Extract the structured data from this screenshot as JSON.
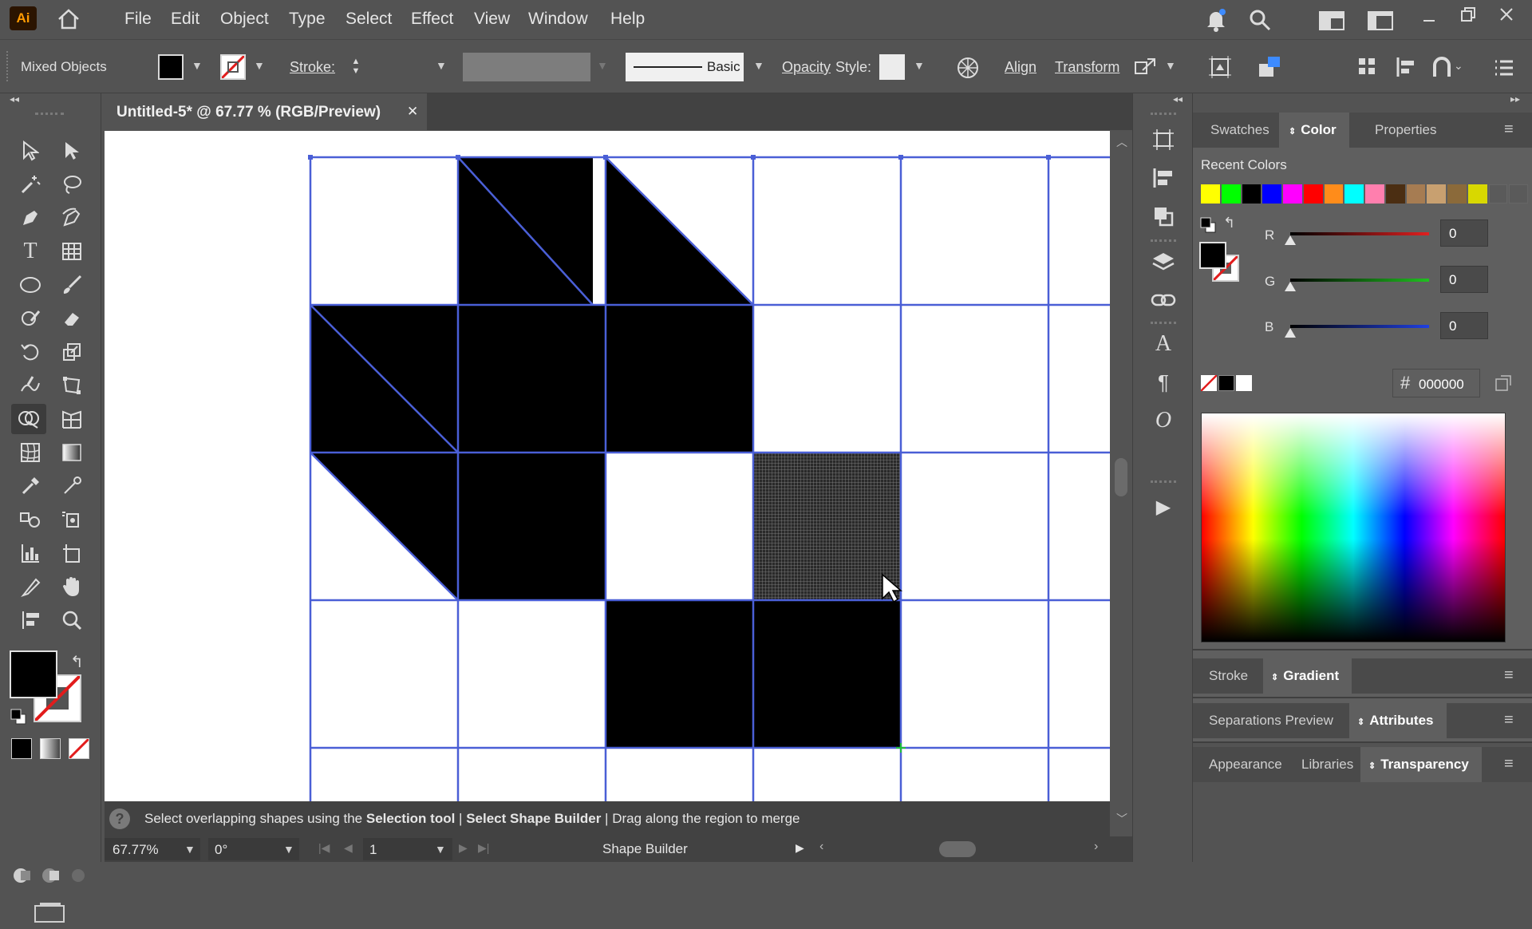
{
  "app": {
    "logo": "Ai"
  },
  "menu": [
    "File",
    "Edit",
    "Object",
    "Type",
    "Select",
    "Effect",
    "View",
    "Window",
    "Help"
  ],
  "control": {
    "selection_label": "Mixed Objects",
    "stroke_label": "Stroke:",
    "brush_label": "Basic",
    "opacity_label": "Opacity",
    "style_label": "Style:",
    "align_label": "Align",
    "transform_label": "Transform"
  },
  "document": {
    "tab_title": "Untitled-5* @ 67.77 % (RGB/Preview)",
    "close_glyph": "✕"
  },
  "status": {
    "help_glyph": "?",
    "hint_parts": [
      "Select overlapping shapes using the ",
      "Selection tool",
      " | ",
      "Select Shape Builder",
      " | Drag along the region to merge"
    ]
  },
  "bottom": {
    "zoom": "67.77%",
    "rotation": "0°",
    "artboard": "1",
    "active_tool": "Shape Builder"
  },
  "panels": {
    "top_tabs": [
      "Swatches",
      "Color",
      "Properties"
    ],
    "recent_colors_label": "Recent Colors",
    "recent_colors": [
      "#ffff00",
      "#00ff00",
      "#000000",
      "#0000ff",
      "#ff00ff",
      "#ff0000",
      "#ff8c1a",
      "#00ffff",
      "#ff7fae",
      "#4b2e12",
      "#a67c52",
      "#c8a070",
      "#8b6a3a",
      "#d8d800"
    ],
    "rgb": [
      {
        "label": "R",
        "value": "0",
        "color": "#e02020"
      },
      {
        "label": "G",
        "value": "0",
        "color": "#20c020"
      },
      {
        "label": "B",
        "value": "0",
        "color": "#2040e0"
      }
    ],
    "hex_prefix": "#",
    "hex": "000000",
    "stroke_tabs": [
      "Stroke",
      "Gradient"
    ],
    "sep_tabs": [
      "Separations Preview",
      "Attributes"
    ],
    "app_tabs": [
      "Appearance",
      "Libraries",
      "Transparency"
    ]
  },
  "colors": {
    "accent_grid": "#4a5fd6",
    "fill": "#000000",
    "merge_preview": "#3a3a3a"
  }
}
